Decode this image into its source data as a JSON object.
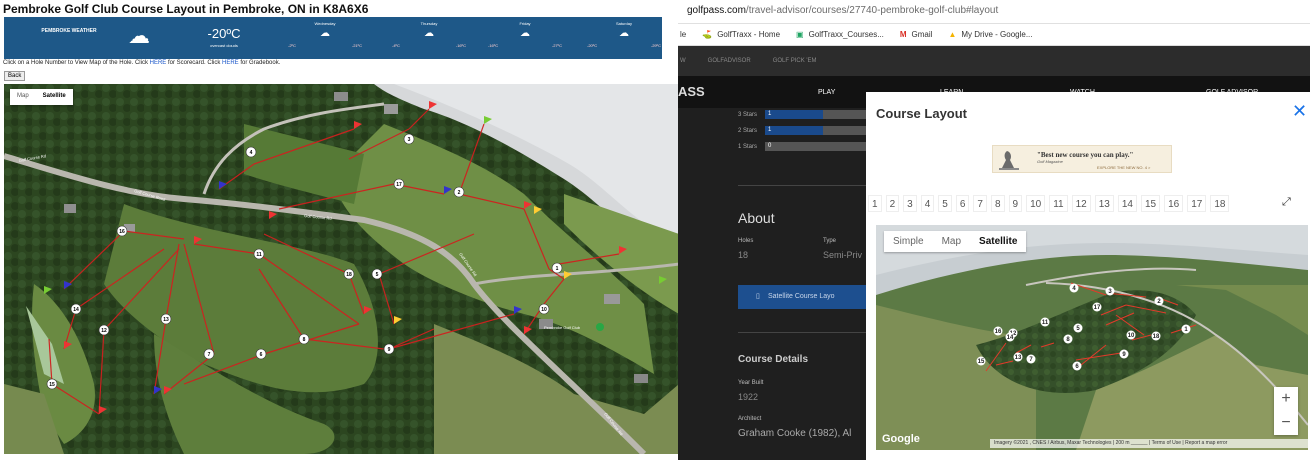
{
  "left": {
    "title": "Pembroke Golf Club Course Layout in Pembroke, ON in K8A6X6",
    "weather": {
      "location": "PEMBROKE WEATHER",
      "current_temp": "-20ºC",
      "condition": "overcast clouds",
      "cloud_icon": "cloud-icon",
      "days": [
        {
          "name": "Wednesday",
          "high": "-2ºC",
          "low": "-21ºC"
        },
        {
          "name": "Thursday",
          "high": "-4ºC",
          "low": "-16ºC"
        },
        {
          "name": "Friday",
          "high": "-16ºC",
          "low": "-27ºC"
        },
        {
          "name": "Saturday",
          "high": "-20ºC",
          "low": "-29ºC"
        }
      ]
    },
    "instructions_prefix": "Click on a Hole Number to View Map of the Hole. Click",
    "here1": "HERE",
    "instructions_mid": "for Scorecard. Click",
    "here2": "HERE",
    "instructions_suffix": "for Gradebook.",
    "back_label": "Back",
    "map_toggle": {
      "map": "Map",
      "satellite": "Satellite"
    },
    "hole_numbers": [
      "1",
      "2",
      "3",
      "4",
      "5",
      "6",
      "7",
      "8",
      "9",
      "10",
      "11",
      "12",
      "13",
      "14",
      "15",
      "16",
      "17",
      "18"
    ],
    "road_labels": [
      "Golf Course Road",
      "Golf Course Rd",
      "Golf Course Rd",
      "Golf Course Rd",
      "Golf Course Rd"
    ],
    "poi_label": "Pembroke Golf Club"
  },
  "right": {
    "url_domain": "golfpass.com",
    "url_path": "/travel-advisor/courses/27740-pembroke-golf-club#layout",
    "bookmarks": [
      {
        "icon": "golftraxx-icon",
        "label": "GolfTraxx - Home"
      },
      {
        "icon": "golftraxx-courses-icon",
        "label": "GolfTraxx_Courses..."
      },
      {
        "icon": "gmail-icon",
        "label": "Gmail"
      },
      {
        "icon": "drive-icon",
        "label": "My Drive - Google..."
      }
    ],
    "bookmark_prefix": "le",
    "subnav": [
      "W",
      "GOLFADVISOR",
      "GOLF PICK 'EM"
    ],
    "logo": "ASS",
    "mainnav": [
      "PLAY",
      "LEARN",
      "WATCH",
      "GOLF ADVISOR"
    ],
    "stars": [
      {
        "label": "3 Stars",
        "count": "1",
        "fill_pct": 50
      },
      {
        "label": "2 Stars",
        "count": "1",
        "fill_pct": 50
      },
      {
        "label": "1 Stars",
        "count": "0",
        "fill_pct": 0
      }
    ],
    "about_title": "About",
    "holes_label": "Holes",
    "holes_value": "18",
    "type_label": "Type",
    "type_value": "Semi-Priv",
    "satellite_button": "Satellite Course Layo",
    "details_title": "Course Details",
    "year_label": "Year Built",
    "year_value": "1922",
    "architect_label": "Architect",
    "architect_value": "Graham Cooke (1982), Al",
    "modal": {
      "title": "Course Layout",
      "ad_headline": "\"Best new course you can play.\"",
      "ad_source": "Golf Magazine",
      "ad_cta": "EXPLORE THE NEW NO. 4 >",
      "hole_tabs": [
        "1",
        "2",
        "3",
        "4",
        "5",
        "6",
        "7",
        "8",
        "9",
        "10",
        "11",
        "12",
        "13",
        "14",
        "15",
        "16",
        "17",
        "18"
      ],
      "map_toggle": [
        "Simple",
        "Map",
        "Satellite"
      ],
      "zoom_in": "+",
      "zoom_out": "−",
      "google": "Google",
      "attribution": "Imagery ©2021 , CNES / Airbus, Maxar Technologies | 200 m ______ | Terms of Use | Report a map error",
      "hole_markers": [
        "1",
        "2",
        "3",
        "4",
        "5",
        "6",
        "7",
        "8",
        "9",
        "10",
        "11",
        "12",
        "13",
        "14",
        "15",
        "16",
        "17",
        "18"
      ]
    }
  }
}
